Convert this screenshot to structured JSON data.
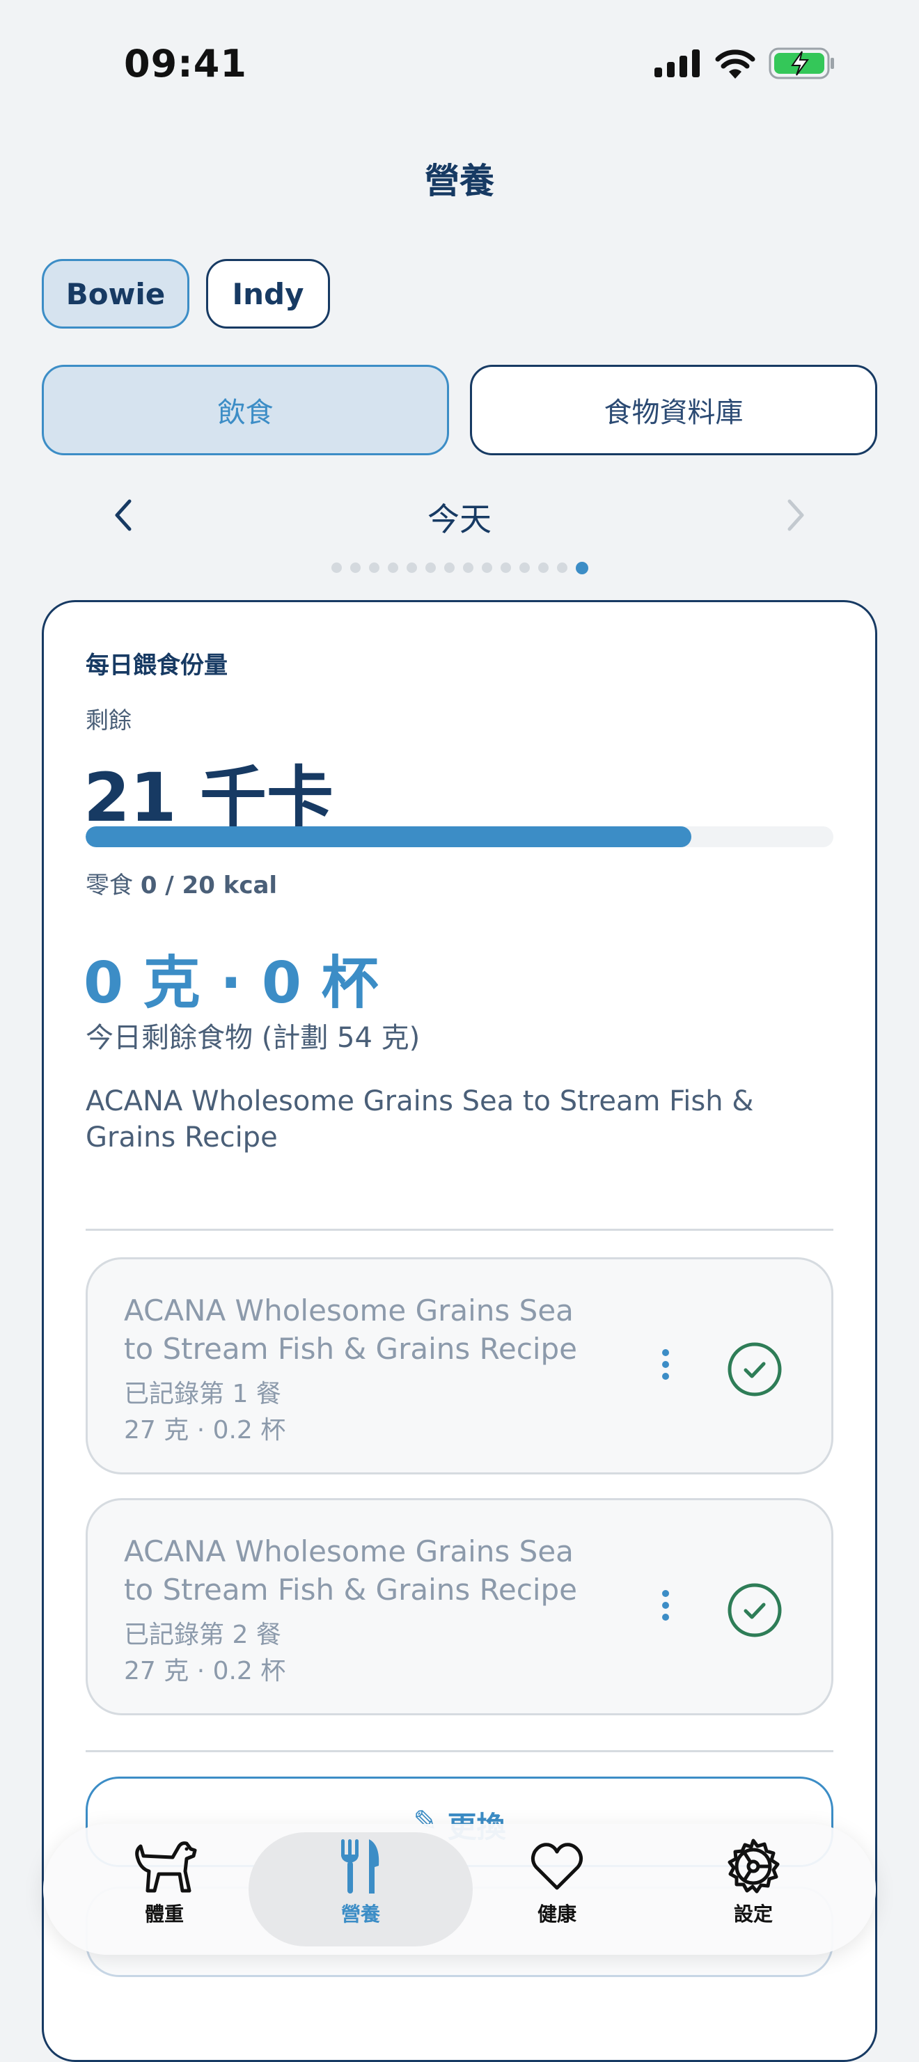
{
  "status_bar": {
    "time": "09:41",
    "icons": [
      "signal-icon",
      "wifi-icon",
      "battery-charging-icon"
    ]
  },
  "header": {
    "title": "營養"
  },
  "pets": [
    {
      "name": "Bowie",
      "active": true
    },
    {
      "name": "Indy",
      "active": false
    }
  ],
  "segments": [
    {
      "label": "飲食",
      "active": true
    },
    {
      "label": "食物資料庫",
      "active": false
    }
  ],
  "day_nav": {
    "label": "今天",
    "page_count": 14,
    "active_page": 14
  },
  "card": {
    "title": "每日餵食份量",
    "remain_label": "剩餘",
    "remain_value": "21 千卡",
    "progress": 0.81,
    "snack_label": "零食",
    "snack_value": "0 / 20 kcal",
    "food_amount": "0 克 · 0 杯",
    "food_sub": "今日剩餘食物 (計劃 54 克)",
    "food_name": "ACANA Wholesome Grains Sea to Stream Fish & Grains Recipe",
    "meals": [
      {
        "name": "ACANA Wholesome Grains Sea to Stream Fish & Grains Recipe",
        "status": "已記錄第 1 餐",
        "amount": "27 克 · 0.2 杯",
        "logged": true
      },
      {
        "name": "ACANA Wholesome Grains Sea to Stream Fish & Grains Recipe",
        "status": "已記錄第 2 餐",
        "amount": "27 克 · 0.2 杯",
        "logged": true
      }
    ],
    "change_label": "更換"
  },
  "tabbar": {
    "tabs": [
      {
        "label": "體重",
        "icon": "dog-icon",
        "active": false
      },
      {
        "label": "營養",
        "icon": "fork-knife-icon",
        "active": true
      },
      {
        "label": "健康",
        "icon": "heart-icon",
        "active": false
      },
      {
        "label": "設定",
        "icon": "gear-icon",
        "active": false
      }
    ]
  },
  "colors": {
    "accent": "#3c8dc6",
    "primary": "#173a63",
    "success": "#2e7d57"
  }
}
